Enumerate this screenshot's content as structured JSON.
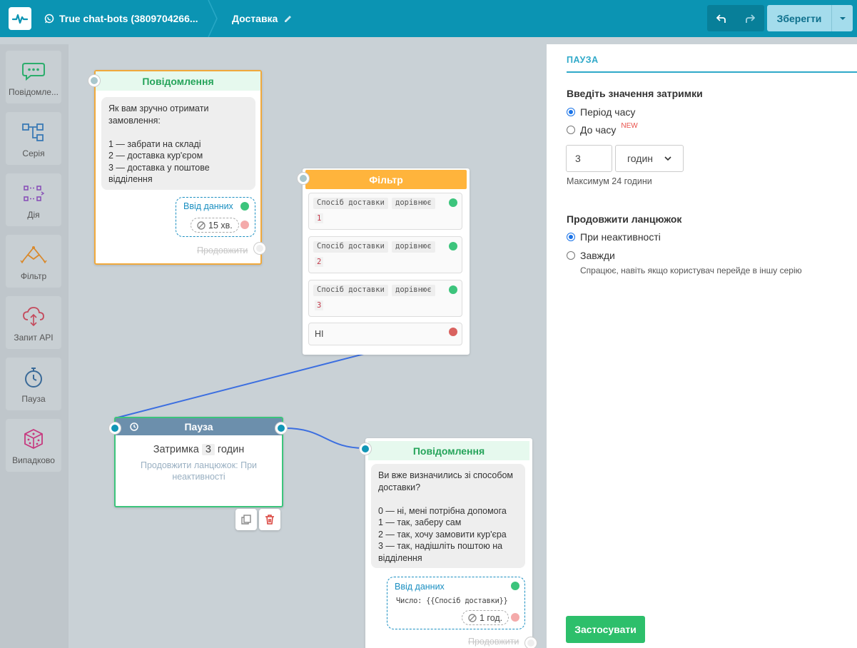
{
  "header": {
    "channel_name": "True chat-bots (3809704266...",
    "flow_name": "Доставка",
    "save_label": "Зберегти"
  },
  "sidebar": {
    "items": [
      {
        "label": "Повідомле...",
        "icon": "chat-bubble-icon"
      },
      {
        "label": "Серія",
        "icon": "flow-tree-icon"
      },
      {
        "label": "Дія",
        "icon": "action-icon"
      },
      {
        "label": "Фільтр",
        "icon": "filter-icon"
      },
      {
        "label": "Запит API",
        "icon": "cloud-api-icon"
      },
      {
        "label": "Пауза",
        "icon": "stopwatch-icon"
      },
      {
        "label": "Випадково",
        "icon": "dice-icon"
      }
    ]
  },
  "canvas": {
    "message1": {
      "title": "Повідомлення",
      "text": "Як вам зручно отримати замовлення:\n\n1 — забрати на складі\n2 — доставка кур'єром\n3 — доставка у поштове відділення",
      "input_label": "Ввід данних",
      "timeout": "15 хв.",
      "continue_label": "Продовжити"
    },
    "filter": {
      "title": "Фільтр",
      "conditions": [
        {
          "field": "Спосіб доставки",
          "op": "дорівнює",
          "value": "1"
        },
        {
          "field": "Спосіб доставки",
          "op": "дорівнює",
          "value": "2"
        },
        {
          "field": "Спосіб доставки",
          "op": "дорівнює",
          "value": "3"
        }
      ],
      "else_label": "НІ"
    },
    "pause": {
      "title": "Пауза",
      "delay_prefix": "Затримка",
      "delay_value": "3",
      "delay_unit": "годин",
      "subtitle": "Продовжити ланцюжок: При неактивності"
    },
    "message2": {
      "title": "Повідомлення",
      "text": "Ви вже визначились зі способом доставки?\n\n0 — ні, мені потрібна допомога\n1 — так, заберу сам\n2 — так, хочу замовити кур'єра\n3 — так, надішліть поштою на відділення",
      "input_label": "Ввід данних",
      "input_var": "Число: {{Спосіб доставки}}",
      "timeout": "1 год.",
      "continue_label": "Продовжити"
    }
  },
  "panel": {
    "title": "ПАУЗА",
    "delay_section": "Введіть значення затримки",
    "radio_period": "Період часу",
    "radio_until": "До часу",
    "new_badge": "NEW",
    "delay_value": "3",
    "delay_unit": "годин",
    "max_hint": "Максимум 24 години",
    "continue_section": "Продовжити ланцюжок",
    "radio_inactive": "При неактивності",
    "radio_always": "Завжди",
    "always_hint": "Спрацює, навіть якщо користувач перейде в іншу серію",
    "apply_label": "Застосувати"
  }
}
